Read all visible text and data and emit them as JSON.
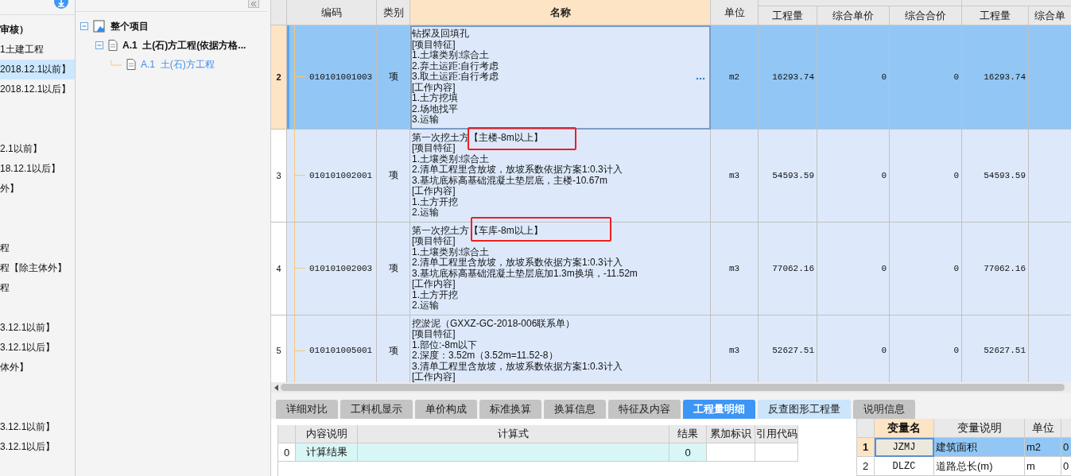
{
  "left_panel": {
    "items": [
      {
        "label": "审核）",
        "bold": true,
        "selected": false
      },
      {
        "label": "1土建工程",
        "bold": false,
        "selected": false
      },
      {
        "label": "2018.12.1以前】",
        "bold": false,
        "selected": true
      },
      {
        "label": "2018.12.1以后】",
        "bold": false,
        "selected": false
      },
      {
        "label": "2.1以前】",
        "bold": false,
        "selected": false
      },
      {
        "label": "18.12.1以后】",
        "bold": false,
        "selected": false
      },
      {
        "label": "外】",
        "bold": false,
        "selected": false
      },
      {
        "label": "程",
        "bold": false,
        "selected": false
      },
      {
        "label": "程【除主体外】",
        "bold": false,
        "selected": false
      },
      {
        "label": "程",
        "bold": false,
        "selected": false
      },
      {
        "label": "3.12.1以前】",
        "bold": false,
        "selected": false
      },
      {
        "label": "3.12.1以后】",
        "bold": false,
        "selected": false
      },
      {
        "label": "体外】",
        "bold": false,
        "selected": false
      },
      {
        "label": "3.12.1以前】",
        "bold": false,
        "selected": false
      },
      {
        "label": "3.12.1以后】",
        "bold": false,
        "selected": false
      }
    ]
  },
  "tree": [
    {
      "label": "整个项目",
      "expanded": true,
      "selected": false,
      "children": [
        {
          "label": "A.1  土(石)方工程(依据方格...",
          "expanded": true,
          "selected": false,
          "children": [
            {
              "label": "A.1  土(石)方工程",
              "selected": true
            }
          ]
        }
      ]
    }
  ],
  "grid": {
    "columns": [
      "编码",
      "类别",
      "名称",
      "单位"
    ],
    "sub_columns": [
      "工程量",
      "综合单价",
      "综合合价",
      "工程量",
      "综合单"
    ],
    "rows": [
      {
        "number": "2",
        "code": "010101001003",
        "type": "项",
        "name_lines": [
          "钻探及回填孔",
          "[项目特征]",
          "1.土壤类别:综合土",
          "2.弃土运距:自行考虑",
          "3.取土运距:自行考虑",
          "[工作内容]",
          "1.土方挖填",
          "2.场地找平",
          "3.运输"
        ],
        "unit": "m2",
        "values": [
          "16293.74",
          "0",
          "0",
          "16293.74"
        ],
        "selected": true,
        "marked": false
      },
      {
        "number": "3",
        "code": "010101002001",
        "type": "项",
        "name_lines": [
          "第一次挖土方【主楼-8m以上】",
          "[项目特征]",
          "1.土壤类别:综合土",
          "2.清单工程里含放坡，放坡系数依据方案1:0.3计入",
          "3.基坑底标高基础混凝土垫层底，主楼-10.67m",
          "[工作内容]",
          "1.土方开挖",
          "2.运输"
        ],
        "unit": "m3",
        "values": [
          "54593.59",
          "0",
          "0",
          "54593.59"
        ],
        "selected": false,
        "marked": true
      },
      {
        "number": "4",
        "code": "010101002003",
        "type": "项",
        "name_lines": [
          "第一次挖土方【车库-8m以上】",
          "[项目特征]",
          "1.土壤类别:综合土",
          "2.清单工程里含放坡，放坡系数依据方案1:0.3计入",
          "3.基坑底标高基础混凝土垫层底加1.3m换填，-11.52m",
          "[工作内容]",
          "1.土方开挖",
          "2.运输"
        ],
        "unit": "m3",
        "values": [
          "77062.16",
          "0",
          "0",
          "77062.16"
        ],
        "selected": false,
        "marked": true
      },
      {
        "number": "5",
        "code": "010101005001",
        "type": "项",
        "name_lines": [
          "挖淤泥（GXXZ-GC-2018-006联系单）",
          "[项目特征]",
          "1.部位:-8m以下",
          "2.深度：3.52m（3.52m=11.52-8）",
          "3.清单工程里含放坡，放坡系数依据方案1:0.3计入",
          "[工作内容]"
        ],
        "unit": "m3",
        "values": [
          "52627.51",
          "0",
          "0",
          "52627.51"
        ],
        "selected": false,
        "marked": false
      }
    ]
  },
  "bottom_tabs": [
    {
      "label": "详细对比",
      "selected": false,
      "hovered": false
    },
    {
      "label": "工料机显示",
      "selected": false,
      "hovered": false
    },
    {
      "label": "单价构成",
      "selected": false,
      "hovered": false
    },
    {
      "label": "标准换算",
      "selected": false,
      "hovered": false
    },
    {
      "label": "换算信息",
      "selected": false,
      "hovered": false
    },
    {
      "label": "特征及内容",
      "selected": false,
      "hovered": false
    },
    {
      "label": "工程量明细",
      "selected": true,
      "hovered": false
    },
    {
      "label": "反查图形工程量",
      "selected": false,
      "hovered": true
    },
    {
      "label": "说明信息",
      "selected": false,
      "hovered": false
    }
  ],
  "calc_table": {
    "columns": [
      "内容说明",
      "计算式",
      "结果",
      "累加标识",
      "引用代码"
    ],
    "rows": [
      {
        "number": "0",
        "description": "计算结果",
        "result": "0"
      }
    ]
  },
  "variable_table": {
    "columns": [
      "变量名",
      "变量说明",
      "单位"
    ],
    "rows": [
      {
        "number": "1",
        "name": "JZMJ",
        "description": "建筑面积",
        "unit": "m2",
        "value": "0",
        "selected": true
      },
      {
        "number": "2",
        "name": "DLZC",
        "description": "道路总长(m)",
        "unit": "m",
        "value": "0",
        "selected": false
      }
    ]
  }
}
